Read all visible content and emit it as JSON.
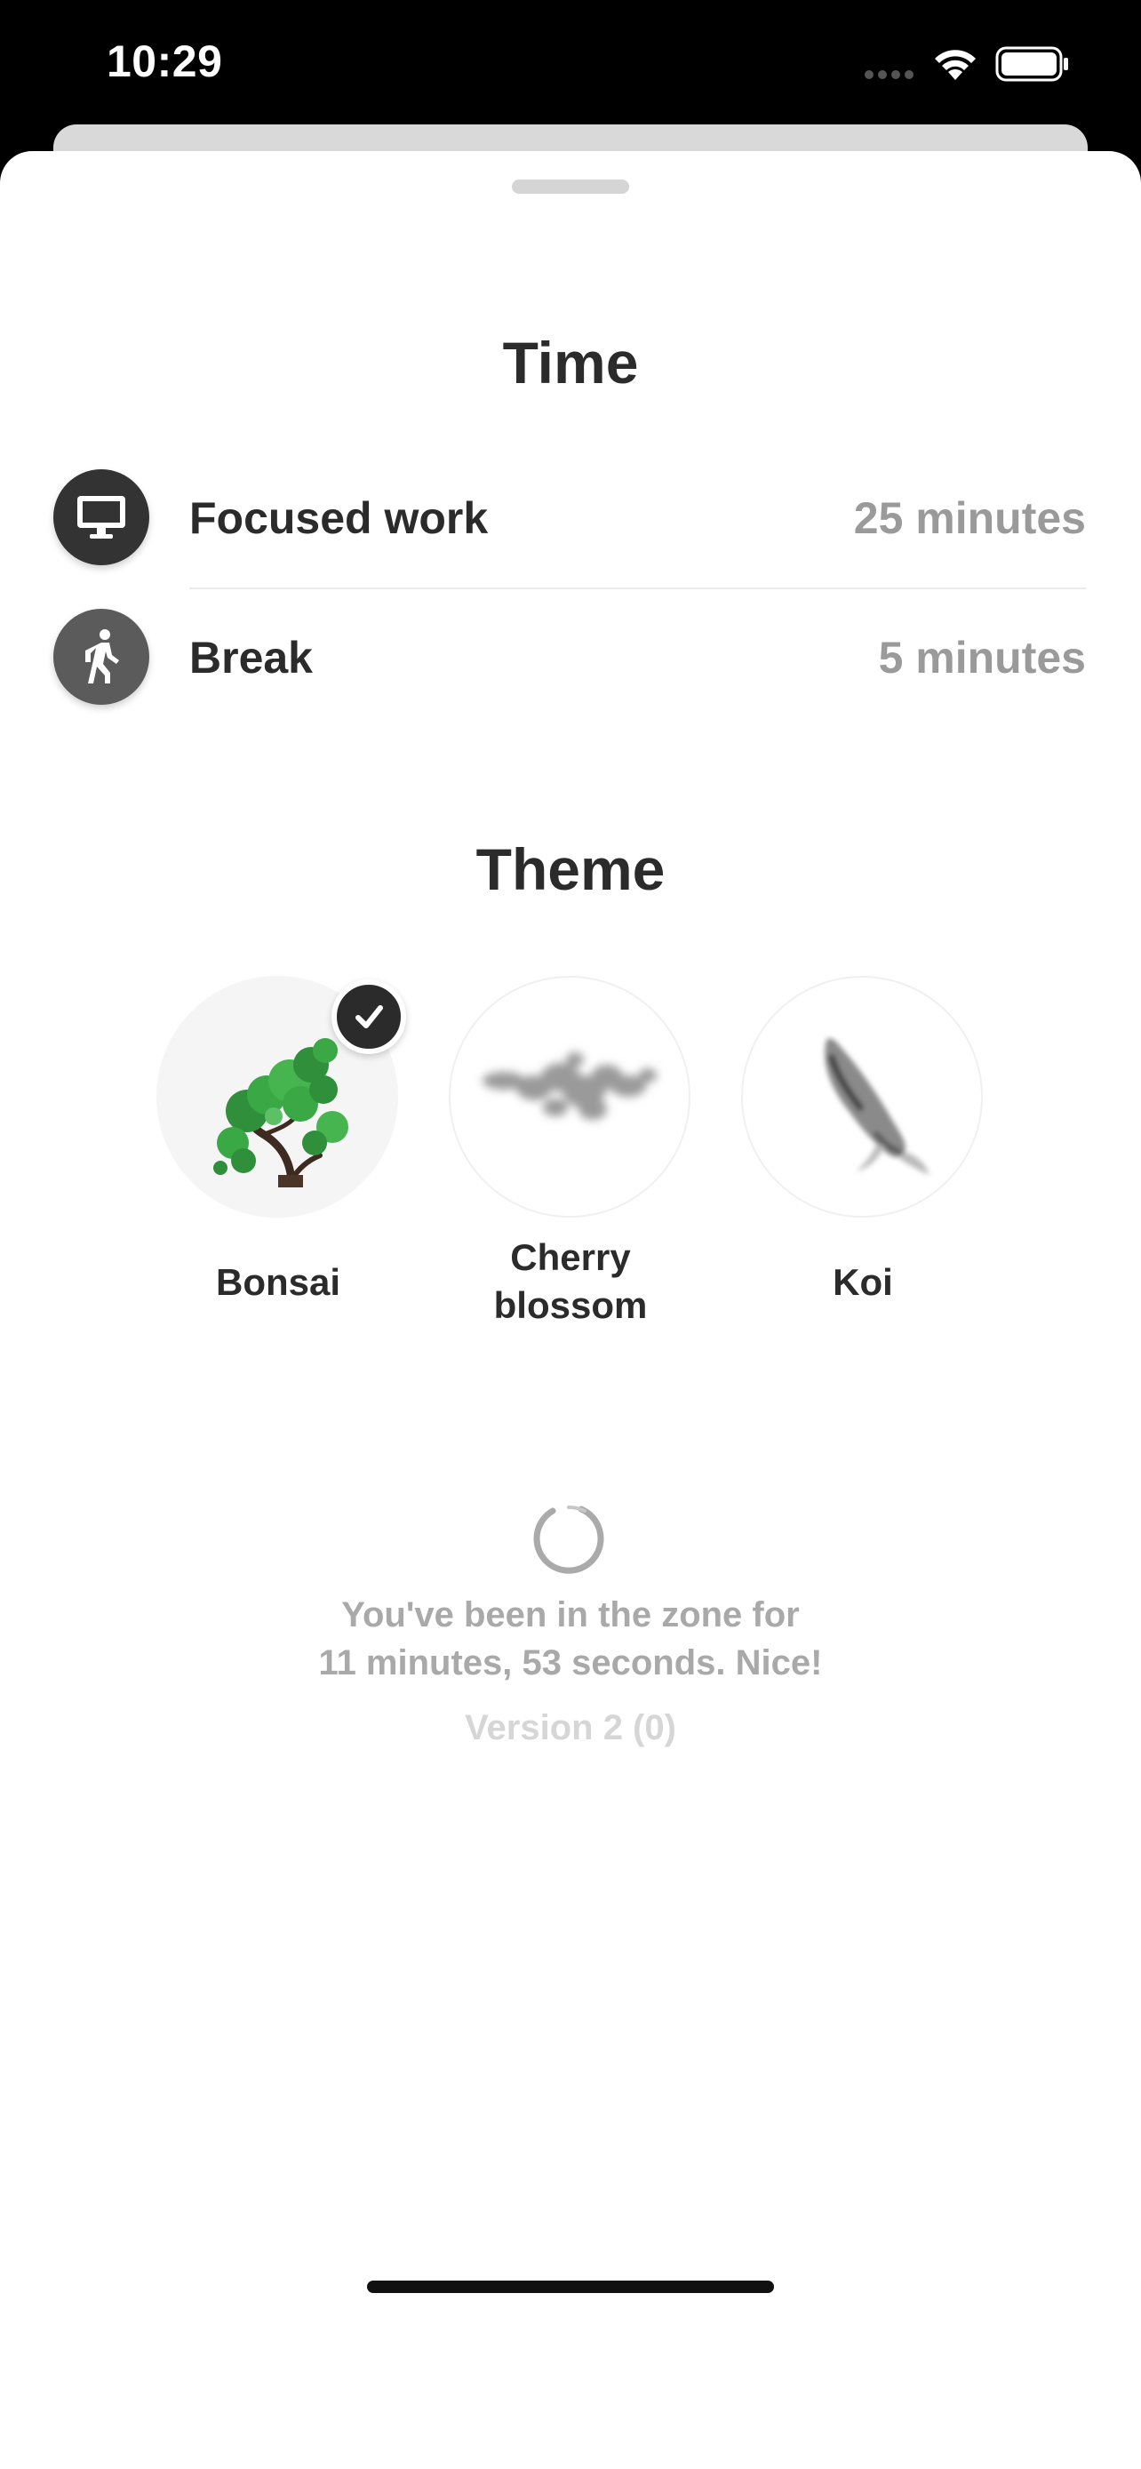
{
  "status_bar": {
    "time": "10:29",
    "icons": [
      "cellular-signal-icon",
      "wifi-icon",
      "battery-icon"
    ]
  },
  "time_section": {
    "title": "Time",
    "rows": [
      {
        "label": "Focused work",
        "value": "25 minutes",
        "icon": "desktop-computer-icon",
        "icon_bg": "#333333"
      },
      {
        "label": "Break",
        "value": "5 minutes",
        "icon": "walking-person-icon",
        "icon_bg": "#5b5b5b"
      }
    ]
  },
  "theme_section": {
    "title": "Theme",
    "themes": [
      {
        "label": "Bonsai",
        "selected": true,
        "icon": "bonsai-tree-image"
      },
      {
        "label": "Cherry\nblossom",
        "selected": false,
        "icon": "cherry-blossom-image"
      },
      {
        "label": "Koi",
        "selected": false,
        "icon": "koi-fish-image"
      }
    ]
  },
  "footer": {
    "zone_line1": "You've been in the zone for",
    "zone_line2": "11 minutes, 53 seconds. Nice!",
    "version": "Version 2 (0)"
  },
  "colors": {
    "text_primary": "#2b2b2b",
    "text_secondary": "#9a9a9a",
    "bonsai_green": "#3aa845"
  }
}
